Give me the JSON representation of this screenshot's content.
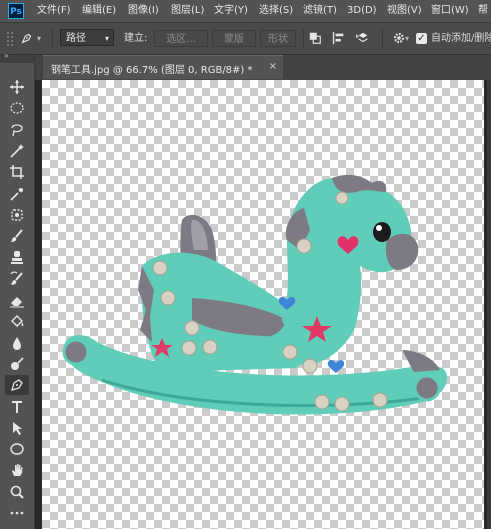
{
  "app": {
    "logo": "Ps"
  },
  "menu": [
    "文件(F)",
    "编辑(E)",
    "图像(I)",
    "图层(L)",
    "文字(Y)",
    "选择(S)",
    "滤镜(T)",
    "3D(D)",
    "视图(V)",
    "窗口(W)",
    "帮"
  ],
  "options": {
    "mode_value": "路径",
    "make_label": "建立:",
    "selection_btn": "选区...",
    "mask_btn": "蒙版",
    "shape_btn": "形状",
    "auto_add_delete": "自动添加/删除",
    "auto_add_checked": true
  },
  "tab": {
    "title": "钢笔工具.jpg @ 66.7% (图层 0, RGB/8#) *",
    "close": "×"
  },
  "tools": [
    {
      "name": "move-tool-icon"
    },
    {
      "name": "marquee-tool-icon"
    },
    {
      "name": "lasso-tool-icon"
    },
    {
      "name": "magic-wand-tool-icon"
    },
    {
      "name": "crop-tool-icon"
    },
    {
      "name": "eyedropper-tool-icon"
    },
    {
      "name": "healing-brush-tool-icon"
    },
    {
      "name": "brush-tool-icon"
    },
    {
      "name": "clone-stamp-tool-icon"
    },
    {
      "name": "history-brush-tool-icon"
    },
    {
      "name": "eraser-tool-icon"
    },
    {
      "name": "paint-bucket-tool-icon"
    },
    {
      "name": "blur-tool-icon"
    },
    {
      "name": "dodge-tool-icon"
    },
    {
      "name": "pen-tool-icon",
      "active": true
    },
    {
      "name": "type-tool-icon"
    },
    {
      "name": "path-selection-tool-icon"
    },
    {
      "name": "ellipse-tool-icon"
    },
    {
      "name": "hand-tool-icon"
    },
    {
      "name": "zoom-tool-icon"
    },
    {
      "name": "more-tools-icon"
    }
  ],
  "colors": {
    "toy_body": "#5fcdb8",
    "toy_dark": "#3fa896",
    "toy_gray": "#7d7a84",
    "heart_pink": "#e0336a",
    "star_pink": "#e23a66",
    "heart_blue": "#3f86d8"
  }
}
